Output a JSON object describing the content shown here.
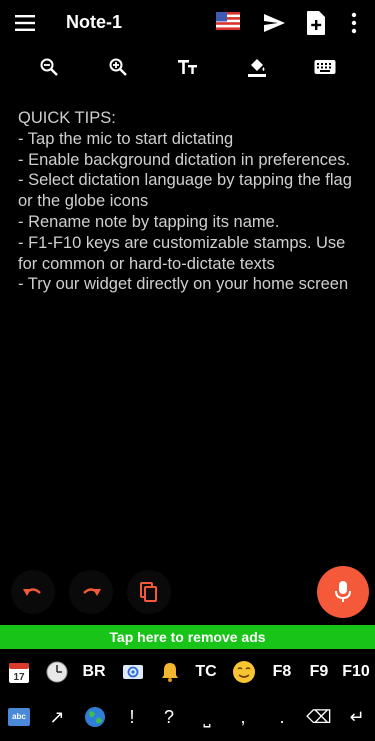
{
  "appbar": {
    "title": "Note-1",
    "icons": [
      "menu-icon",
      "us-flag-icon",
      "send-icon",
      "new-note-icon",
      "more-vert-icon"
    ]
  },
  "toolbar": {
    "tools": [
      "zoom-out-icon",
      "zoom-in-icon",
      "text-size-icon",
      "fill-color-icon",
      "keyboard-icon"
    ]
  },
  "note": {
    "text": "QUICK TIPS:\n- Tap the mic to start dictating\n- Enable background dictation in preferences.\n- Select dictation language by tapping the flag or the globe icons\n- Rename note by tapping its name.\n- F1-F10 keys are customizable stamps. Use for common or hard-to-dictate texts\n- Try our widget directly on your home screen"
  },
  "actions": {
    "icons": [
      "undo-icon",
      "redo-icon",
      "copy-icon",
      "mic-icon"
    ],
    "accent": "#f4593a"
  },
  "ad": {
    "label": "Tap here to remove ads",
    "color": "#18c418"
  },
  "stamps": {
    "row": [
      {
        "icon": "calendar-icon"
      },
      {
        "icon": "clock-icon"
      },
      {
        "label": "BR"
      },
      {
        "icon": "email-icon"
      },
      {
        "icon": "bell-icon"
      },
      {
        "label": "TC"
      },
      {
        "icon": "smiley-icon"
      },
      {
        "label": "F8"
      },
      {
        "label": "F9"
      },
      {
        "label": "F10"
      }
    ]
  },
  "keys": {
    "abc": "abc",
    "row": [
      "↗",
      "🌐",
      "!",
      "?",
      "⎵",
      ",",
      ".",
      "⌫",
      "↵"
    ]
  }
}
